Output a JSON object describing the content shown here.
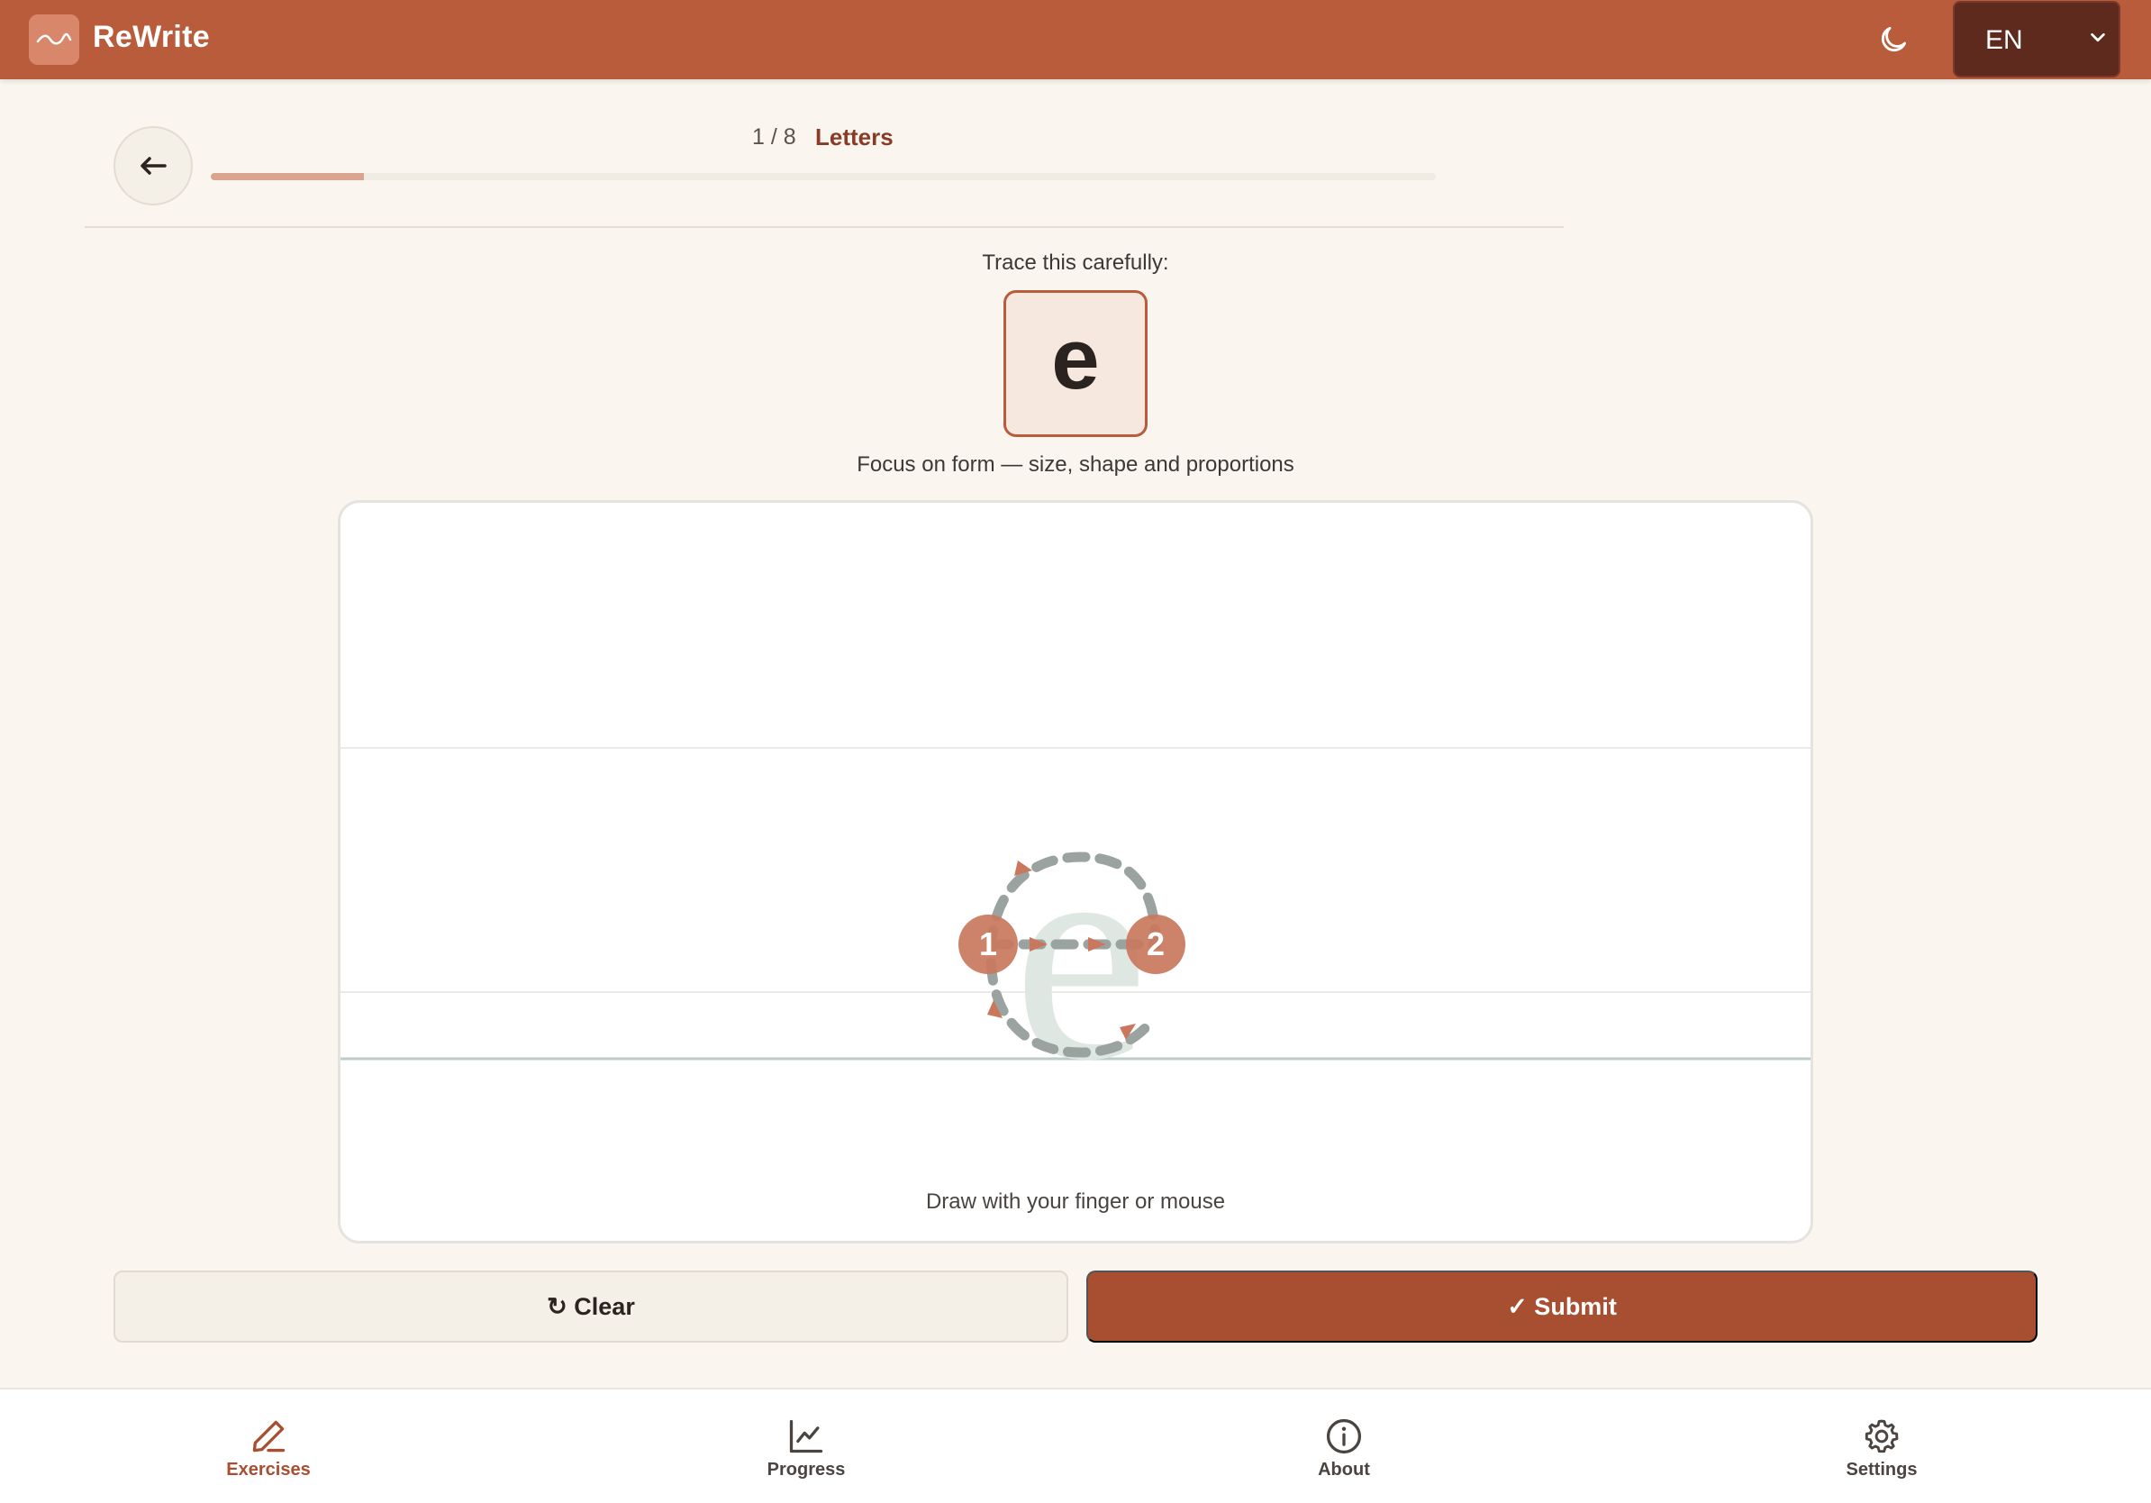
{
  "header": {
    "app_title": "ReWrite",
    "language": "EN",
    "icons": {
      "logo": "wave-logo-icon",
      "theme": "moon-icon",
      "lang_caret": "chevron-down-icon"
    }
  },
  "exercise": {
    "counter": "1 / 8",
    "category": "Letters",
    "progress_fraction": 0.125,
    "prompt": "Trace this carefully:",
    "target_letter": "e",
    "focus": "Focus on form — size, shape and proportions",
    "guide_letter": "e",
    "stroke_numbers": [
      "1",
      "2"
    ],
    "canvas_hint": "Draw with your finger or mouse"
  },
  "actions": {
    "clear_label": "↻ Clear",
    "submit_label": "✓ Submit"
  },
  "nav": {
    "items": [
      {
        "label": "Exercises",
        "icon": "pencil-icon",
        "active": true
      },
      {
        "label": "Progress",
        "icon": "chart-icon",
        "active": false
      },
      {
        "label": "About",
        "icon": "info-icon",
        "active": false
      },
      {
        "label": "Settings",
        "icon": "gear-icon",
        "active": false
      }
    ]
  },
  "colors": {
    "brand": "#b95c3b",
    "accent": "#a84e31",
    "guide_fill": "#dfe7e2",
    "stroke_marker": "#c9785d",
    "dash": "#9aa39f"
  }
}
